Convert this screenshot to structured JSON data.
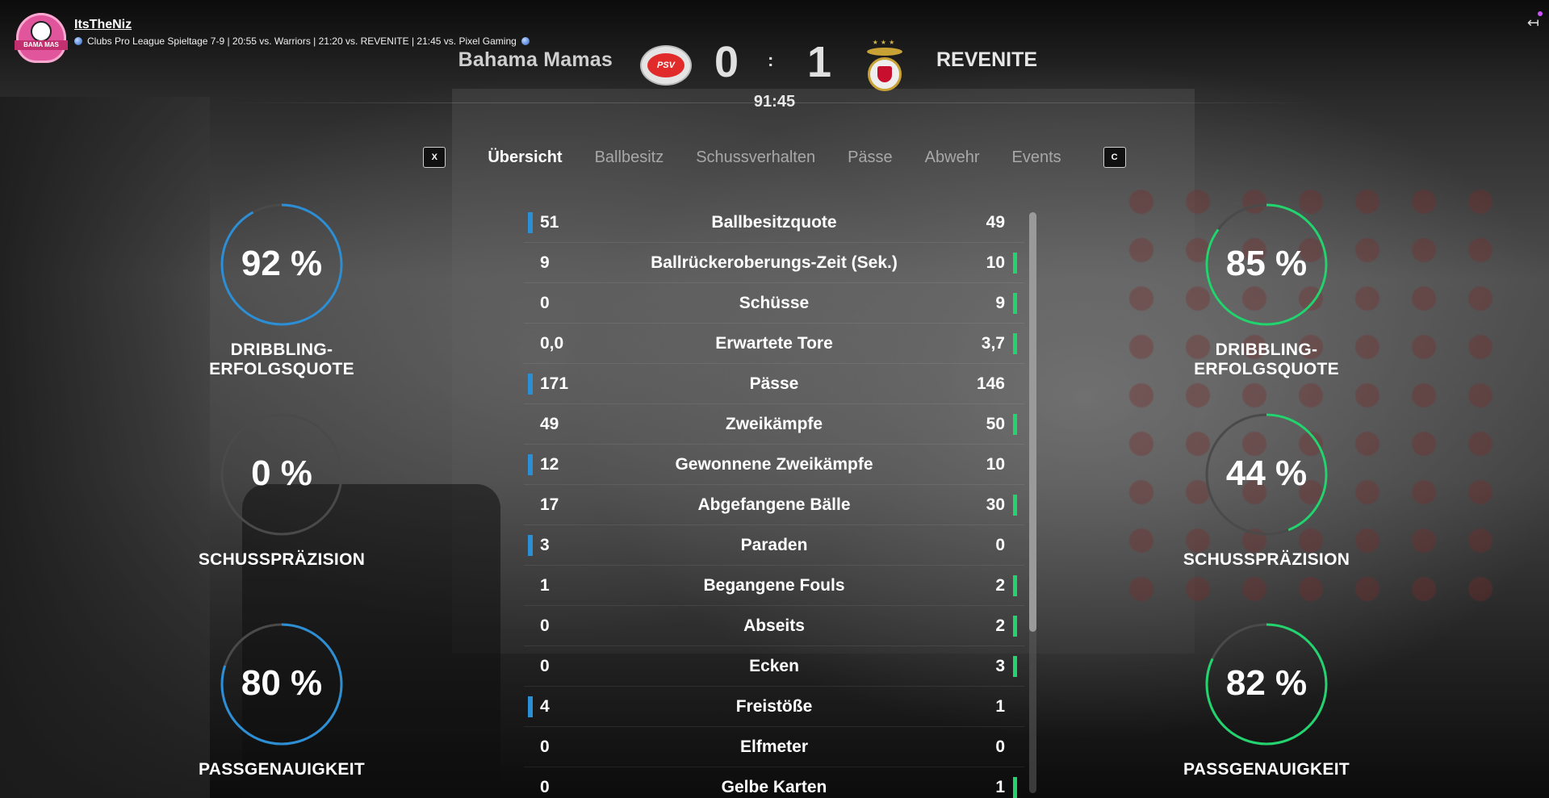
{
  "overlay": {
    "streamer_name": "ItsTheNiz",
    "subtitle": "Clubs Pro League Spieltage 7-9 | 20:55 vs. Warriors | 21:20 vs. REVENITE | 21:45 vs. Pixel Gaming",
    "logo_text": "BAMA MAS"
  },
  "match": {
    "home_team": "Bahama Mamas",
    "away_team": "REVENITE",
    "home_score": "0",
    "separator": ":",
    "away_score": "1",
    "time": "91:45",
    "home_crest_text": "PSV"
  },
  "tabs": {
    "left_key": "X",
    "right_key": "C",
    "items": [
      "Übersicht",
      "Ballbesitz",
      "Schussverhalten",
      "Pässe",
      "Abwehr",
      "Events"
    ],
    "active_index": 0
  },
  "gauges": {
    "home": [
      {
        "value_text": "92 %",
        "value": 92,
        "label": "DRIBBLING-ERFOLGSQUOTE"
      },
      {
        "value_text": "0 %",
        "value": 0,
        "label": "SCHUSSPRÄZISION"
      },
      {
        "value_text": "80 %",
        "value": 80,
        "label": "PASSGENAUIGKEIT"
      }
    ],
    "away": [
      {
        "value_text": "85 %",
        "value": 85,
        "label": "DRIBBLING-ERFOLGSQUOTE"
      },
      {
        "value_text": "44 %",
        "value": 44,
        "label": "SCHUSSPRÄZISION"
      },
      {
        "value_text": "82 %",
        "value": 82,
        "label": "PASSGENAUIGKEIT"
      }
    ]
  },
  "stats": [
    {
      "label": "Ballbesitzquote",
      "home": "51",
      "away": "49",
      "leader": "home"
    },
    {
      "label": "Ballrückeroberungs-Zeit (Sek.)",
      "home": "9",
      "away": "10",
      "leader": "away"
    },
    {
      "label": "Schüsse",
      "home": "0",
      "away": "9",
      "leader": "away"
    },
    {
      "label": "Erwartete Tore",
      "home": "0,0",
      "away": "3,7",
      "leader": "away"
    },
    {
      "label": "Pässe",
      "home": "171",
      "away": "146",
      "leader": "home"
    },
    {
      "label": "Zweikämpfe",
      "home": "49",
      "away": "50",
      "leader": "away"
    },
    {
      "label": "Gewonnene Zweikämpfe",
      "home": "12",
      "away": "10",
      "leader": "home"
    },
    {
      "label": "Abgefangene Bälle",
      "home": "17",
      "away": "30",
      "leader": "away"
    },
    {
      "label": "Paraden",
      "home": "3",
      "away": "0",
      "leader": "home"
    },
    {
      "label": "Begangene Fouls",
      "home": "1",
      "away": "2",
      "leader": "away"
    },
    {
      "label": "Abseits",
      "home": "0",
      "away": "2",
      "leader": "away"
    },
    {
      "label": "Ecken",
      "home": "0",
      "away": "3",
      "leader": "away"
    },
    {
      "label": "Freistöße",
      "home": "4",
      "away": "1",
      "leader": "home"
    },
    {
      "label": "Elfmeter",
      "home": "0",
      "away": "0",
      "leader": "none"
    },
    {
      "label": "Gelbe Karten",
      "home": "0",
      "away": "1",
      "leader": "away"
    }
  ],
  "colors": {
    "home_accent": "#2c8fd6",
    "away_accent": "#22d36e",
    "gauge_track": "#4a4a4a",
    "streamer_pink": "#e0559b"
  },
  "icons": {
    "exit": "exit-icon",
    "ball": "soccer-ball-icon"
  }
}
